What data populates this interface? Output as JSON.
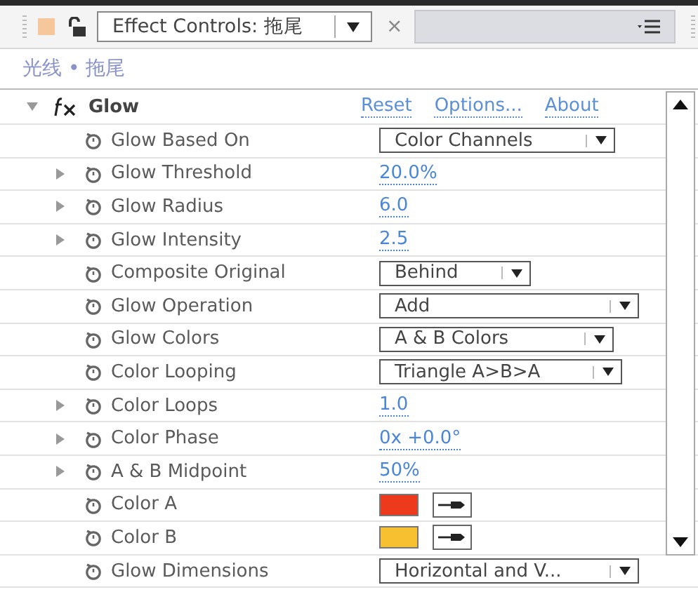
{
  "panel": {
    "tab_title": "Effect Controls: 拖尾",
    "close": "×"
  },
  "breadcrumb": "光线 • 拖尾",
  "effect": {
    "name": "Glow",
    "expanded": true,
    "links": [
      "Reset",
      "Options...",
      "About"
    ]
  },
  "properties": [
    {
      "kind": "dropdown",
      "name": "Glow Based On",
      "expandable": false,
      "value": "Color Channels"
    },
    {
      "kind": "value",
      "name": "Glow Threshold",
      "expandable": true,
      "value": "20.0%"
    },
    {
      "kind": "value",
      "name": "Glow Radius",
      "expandable": true,
      "value": "6.0"
    },
    {
      "kind": "value",
      "name": "Glow Intensity",
      "expandable": true,
      "value": "2.5"
    },
    {
      "kind": "dropdown",
      "name": "Composite Original",
      "expandable": false,
      "value": "Behind"
    },
    {
      "kind": "dropdown",
      "name": "Glow Operation",
      "expandable": false,
      "value": "Add"
    },
    {
      "kind": "dropdown",
      "name": "Glow Colors",
      "expandable": false,
      "value": "A & B Colors"
    },
    {
      "kind": "dropdown",
      "name": "Color Looping",
      "expandable": false,
      "value": "Triangle A>B>A"
    },
    {
      "kind": "value",
      "name": "Color Loops",
      "expandable": true,
      "value": "1.0"
    },
    {
      "kind": "value",
      "name": "Color Phase",
      "expandable": true,
      "value": "0x +0.0°"
    },
    {
      "kind": "value",
      "name": "A & B Midpoint",
      "expandable": true,
      "value": "50%"
    },
    {
      "kind": "color",
      "name": "Color A",
      "expandable": false,
      "color": "#ee3a1c"
    },
    {
      "kind": "color",
      "name": "Color B",
      "expandable": false,
      "color": "#f7c030"
    },
    {
      "kind": "dropdown",
      "name": "Glow Dimensions",
      "expandable": false,
      "value": "Horizontal and V..."
    }
  ]
}
